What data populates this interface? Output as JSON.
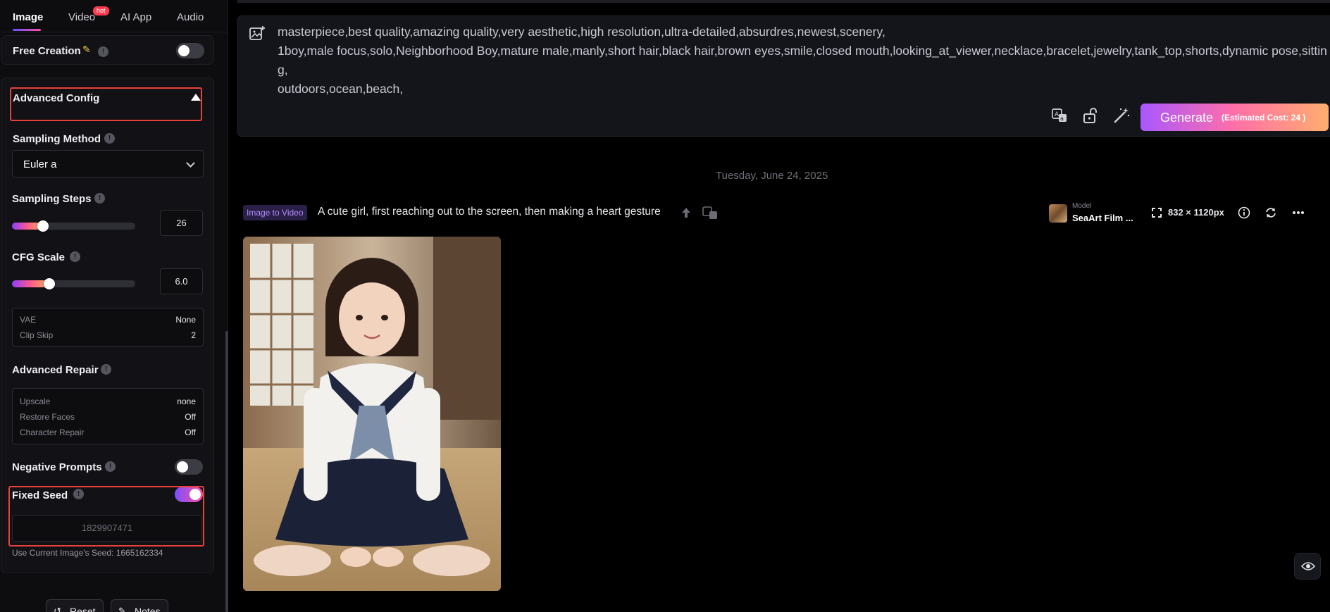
{
  "tabs": [
    {
      "label": "Image"
    },
    {
      "label": "Video",
      "badge": "hot"
    },
    {
      "label": "AI App"
    },
    {
      "label": "Audio"
    }
  ],
  "free_creation": {
    "label": "Free Creation",
    "enabled": false
  },
  "advanced_config": {
    "label": "Advanced Config"
  },
  "sampling_method": {
    "label": "Sampling Method",
    "value": "Euler a"
  },
  "sampling_steps": {
    "label": "Sampling Steps",
    "value": "26",
    "level": 0.25
  },
  "cfg_scale": {
    "label": "CFG Scale",
    "value": "6.0",
    "level": 0.3
  },
  "model_settings": [
    {
      "key": "VAE",
      "value": "None"
    },
    {
      "key": "Clip Skip",
      "value": "2"
    }
  ],
  "advanced_repair": {
    "label": "Advanced Repair",
    "rows": [
      {
        "key": "Upscale",
        "value": "none"
      },
      {
        "key": "Restore Faces",
        "value": "Off"
      },
      {
        "key": "Character Repair",
        "value": "Off"
      }
    ]
  },
  "negative_prompts": {
    "label": "Negative Prompts",
    "enabled": false
  },
  "fixed_seed": {
    "label": "Fixed Seed",
    "enabled": true,
    "placeholder": "1829907471",
    "current_seed_note": "Use Current Image's Seed: 1665162334"
  },
  "bottom_buttons": {
    "reset": "Reset",
    "notes": "Notes"
  },
  "prompt": {
    "text": "masterpiece,best quality,amazing quality,very aesthetic,high resolution,ultra-detailed,absurdres,newest,scenery,\n1boy,male focus,solo,Neighborhood Boy,mature male,manly,short hair,black hair,brown eyes,smile,closed mouth,looking_at_viewer,necklace,bracelet,jewelry,tank_top,shorts,dynamic pose,sitting,\noutdoors,ocean,beach,"
  },
  "generate": {
    "label": "Generate",
    "cost": "(Estimated Cost: 24 )"
  },
  "date": "Tuesday, June 24, 2025",
  "result": {
    "badge": "Image to Video",
    "prompt": "A cute girl, first reaching out to the screen, then making a heart gesture",
    "model_label": "Model",
    "model_name": "SeaArt Film ...",
    "dimensions": "832 × 1120px"
  },
  "icons": {
    "prompt_image": "image-plus-icon",
    "translate": "translate-icon",
    "unlock": "unlock-icon",
    "magic": "magic-wand-icon",
    "upload": "arrow-up-icon",
    "expand": "expand-icon",
    "info": "info-icon",
    "refresh": "refresh-icon",
    "more": "more-icon",
    "eye": "eye-icon"
  },
  "colors": {
    "accent": "#ff4fa3",
    "highlight": "#e8413a",
    "badge": "#b48dff"
  }
}
